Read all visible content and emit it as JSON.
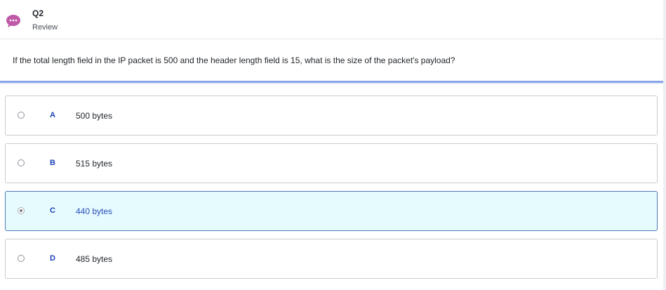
{
  "header": {
    "question_number": "Q2",
    "status": "Review",
    "icon": "chat-bubble-icon",
    "icon_color": "#c05aa7"
  },
  "question": {
    "text": "If the total length field in the IP packet is 500 and the header length field is 15, what is the size of the packet's payload?"
  },
  "options": [
    {
      "letter": "A",
      "text": "500 bytes",
      "selected": false
    },
    {
      "letter": "B",
      "text": "515 bytes",
      "selected": false
    },
    {
      "letter": "C",
      "text": "440 bytes",
      "selected": true
    },
    {
      "letter": "D",
      "text": "485 bytes",
      "selected": false
    }
  ],
  "colors": {
    "accent": "#1a3fb5",
    "selected_background": "#e6fbfe",
    "selected_border": "#4e78b9",
    "divider": "#8aa4e8"
  }
}
